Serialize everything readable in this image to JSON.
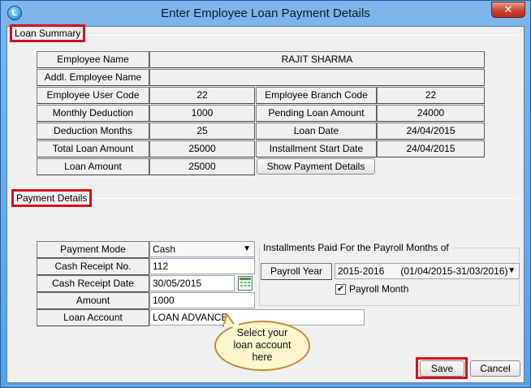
{
  "window": {
    "title": "Enter Employee Loan Payment Details",
    "close_label": "✕",
    "icon": "app-icon"
  },
  "loan_summary": {
    "section_label": "Loan Summary",
    "employee_name_label": "Employee Name",
    "employee_name": "RAJIT SHARMA",
    "addl_employee_name_label": "Addl. Employee Name",
    "addl_employee_name": "",
    "employee_user_code_label": "Employee User Code",
    "employee_user_code": "22",
    "employee_branch_code_label": "Employee Branch Code",
    "employee_branch_code": "22",
    "monthly_deduction_label": "Monthly Deduction",
    "monthly_deduction": "1000",
    "pending_loan_amount_label": "Pending Loan Amount",
    "pending_loan_amount": "24000",
    "deduction_months_label": "Deduction Months",
    "deduction_months": "25",
    "loan_date_label": "Loan Date",
    "loan_date": "24/04/2015",
    "total_loan_amount_label": "Total Loan Amount",
    "total_loan_amount": "25000",
    "installment_start_date_label": "Installment Start Date",
    "installment_start_date": "24/04/2015",
    "loan_amount_label": "Loan Amount",
    "loan_amount": "25000",
    "show_payment_details_label": "Show Payment Details"
  },
  "payment_details": {
    "section_label": "Payment Details",
    "payment_mode_label": "Payment Mode",
    "payment_mode": "Cash",
    "cash_receipt_no_label": "Cash Receipt No.",
    "cash_receipt_no": "112",
    "cash_receipt_date_label": "Cash Receipt Date",
    "cash_receipt_date": "30/05/2015",
    "amount_label": "Amount",
    "amount": "1000",
    "loan_account_label": "Loan Account",
    "loan_account": "LOAN ADVANCE"
  },
  "installments": {
    "legend": "Installments Paid For the Payroll Months of",
    "payroll_year_label": "Payroll Year",
    "payroll_year": "2015-2016      (01/04/2015-31/03/2016)",
    "payroll_month_label": "Payroll Month",
    "payroll_month_checked": true
  },
  "callout": {
    "line1": "Select your",
    "line2": "loan account",
    "line3": "here"
  },
  "footer": {
    "save_label": "Save",
    "cancel_label": "Cancel"
  }
}
